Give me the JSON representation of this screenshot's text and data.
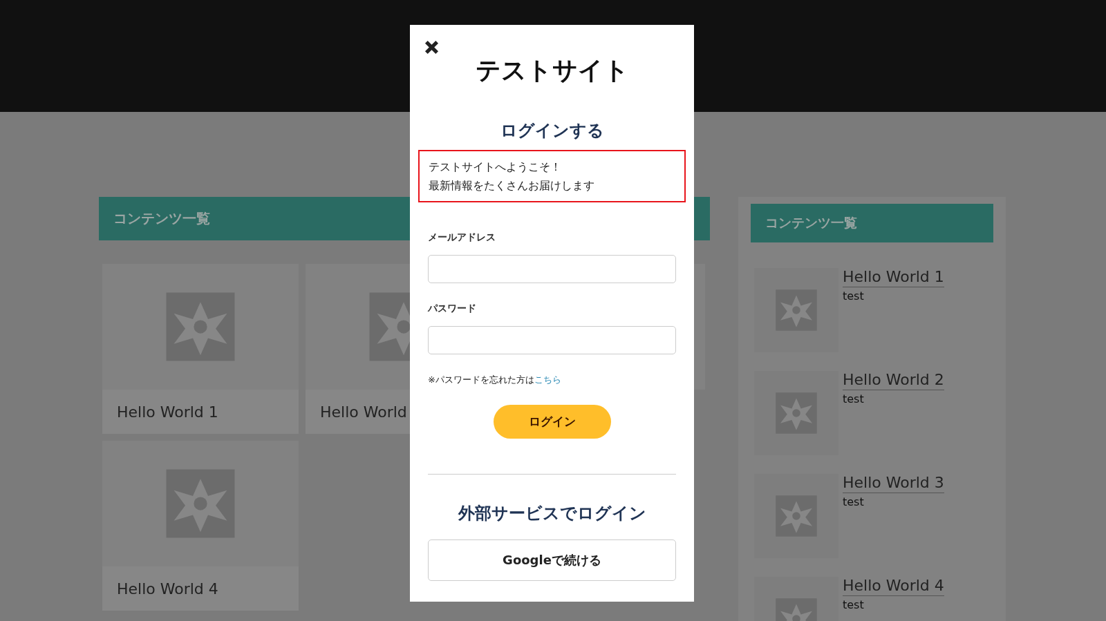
{
  "main": {
    "heading": "コンテンツ一覧",
    "cards": [
      {
        "title": "Hello World 1"
      },
      {
        "title": "Hello World"
      },
      {
        "title": "Hello World 4"
      }
    ]
  },
  "sidebar": {
    "heading": "コンテンツ一覧",
    "items": [
      {
        "title": "Hello World 1",
        "excerpt": "test"
      },
      {
        "title": "Hello World 2",
        "excerpt": "test"
      },
      {
        "title": "Hello World 3",
        "excerpt": "test"
      },
      {
        "title": "Hello World 4",
        "excerpt": "test"
      }
    ]
  },
  "modal": {
    "site_title": "テストサイト",
    "heading": "ログインする",
    "notice": [
      "テストサイトへようこそ！",
      "最新情報をたくさんお届けします"
    ],
    "fields": [
      {
        "label": "メールアドレス"
      },
      {
        "label": "パスワード"
      }
    ],
    "forgot": {
      "text": "※パスワードを忘れた方は",
      "link": "こちら"
    },
    "login_button": "ログイン",
    "external_heading": "外部サービスでログイン",
    "external_buttons": [
      "Googleで続ける"
    ]
  }
}
